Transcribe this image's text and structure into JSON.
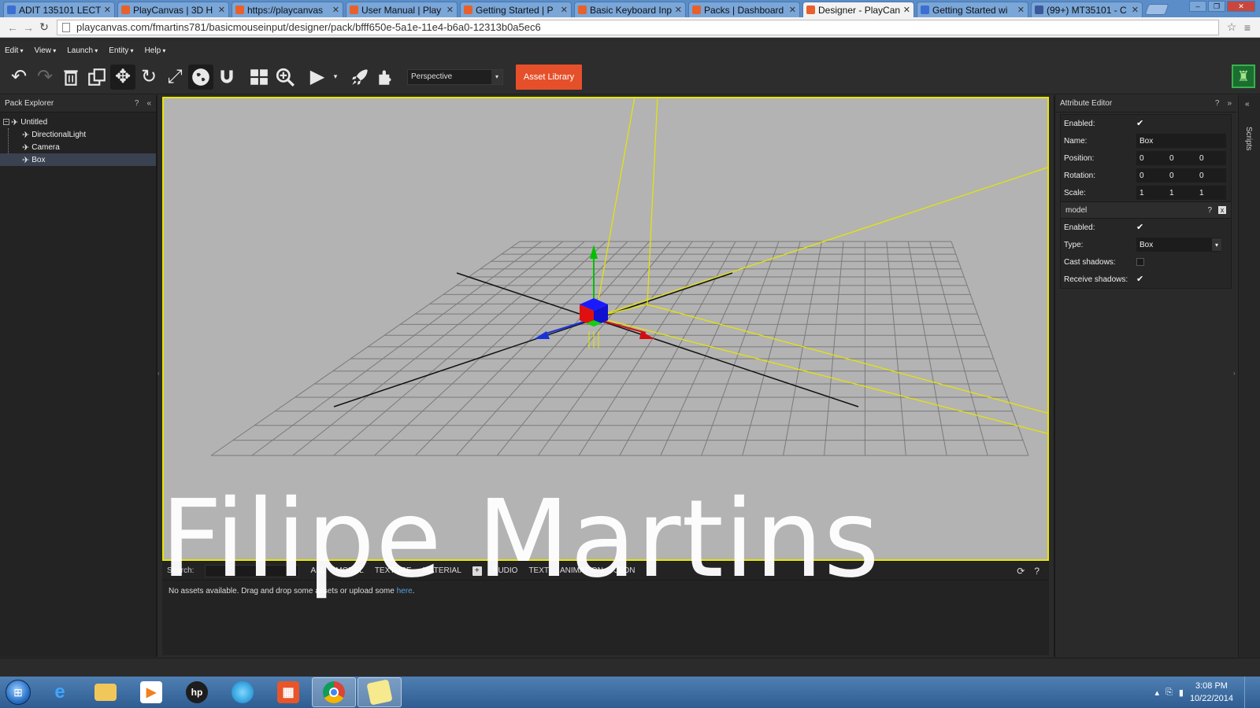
{
  "browser": {
    "tabs": [
      {
        "label": "ADIT 135101 LECT",
        "icon": "docs-icon"
      },
      {
        "label": "PlayCanvas | 3D H",
        "icon": "playcanvas-icon"
      },
      {
        "label": "https://playcanvas",
        "icon": "playcanvas-icon"
      },
      {
        "label": "User Manual | Play",
        "icon": "playcanvas-icon"
      },
      {
        "label": "Getting Started | P",
        "icon": "playcanvas-icon"
      },
      {
        "label": "Basic Keyboard Inp",
        "icon": "playcanvas-icon"
      },
      {
        "label": "Packs | Dashboard",
        "icon": "playcanvas-icon"
      },
      {
        "label": "Designer - PlayCan",
        "icon": "playcanvas-icon",
        "active": true
      },
      {
        "label": "Getting Started wi",
        "icon": "page-icon"
      },
      {
        "label": "(99+) MT35101 - C",
        "icon": "facebook-icon"
      }
    ],
    "url": "playcanvas.com/fmartins781/basicmouseinput/designer/pack/bfff650e-5a1e-11e4-b6a0-12313b0a5ec6"
  },
  "menubar": {
    "items": [
      "Edit",
      "View",
      "Launch",
      "Entity",
      "Help"
    ]
  },
  "toolbar": {
    "camera": "Perspective",
    "asset_library": "Asset Library",
    "accent": "#e5502b"
  },
  "pack_explorer": {
    "title": "Pack Explorer",
    "help": "?",
    "collapse": "«",
    "root": "Untitled",
    "children": [
      "DirectionalLight",
      "Camera",
      "Box"
    ],
    "selected": "Box"
  },
  "viewport": {
    "border_color": "#e6e600",
    "background": "#b3b3b3"
  },
  "assets": {
    "search_label": "Search:",
    "tabs": [
      "ALL",
      "MODEL",
      "TEXTURE",
      "MATERIAL",
      "AUDIO",
      "TEXT",
      "ANIMATION",
      "JSON"
    ],
    "message_prefix": "No assets available. Drag and drop some assets or upload some ",
    "message_link": "here",
    "message_suffix": "."
  },
  "attribute_editor": {
    "title": "Attribute Editor",
    "help": "?",
    "collapse": "»",
    "enabled_label": "Enabled:",
    "name_label": "Name:",
    "name_value": "Box",
    "position_label": "Position:",
    "position": [
      "0",
      "0",
      "0"
    ],
    "rotation_label": "Rotation:",
    "rotation": [
      "0",
      "0",
      "0"
    ],
    "scale_label": "Scale:",
    "scale": [
      "1",
      "1",
      "1"
    ],
    "model": {
      "title": "model",
      "help": "?",
      "remove": "x",
      "enabled_label": "Enabled:",
      "type_label": "Type:",
      "type_value": "Box",
      "cast_shadows_label": "Cast shadows:",
      "cast_shadows": false,
      "receive_shadows_label": "Receive shadows:",
      "receive_shadows": true
    }
  },
  "scripts_panel": {
    "label": "Scripts",
    "collapse": "«"
  },
  "watermark": "Filipe Martins",
  "taskbar": {
    "apps": [
      "internet-explorer-icon",
      "file-explorer-icon",
      "media-player-icon",
      "hp-icon",
      "circle-app-icon",
      "office-icon",
      "chrome-icon",
      "sticky-notes-icon"
    ],
    "time": "3:08 PM",
    "date": "10/22/2014"
  }
}
